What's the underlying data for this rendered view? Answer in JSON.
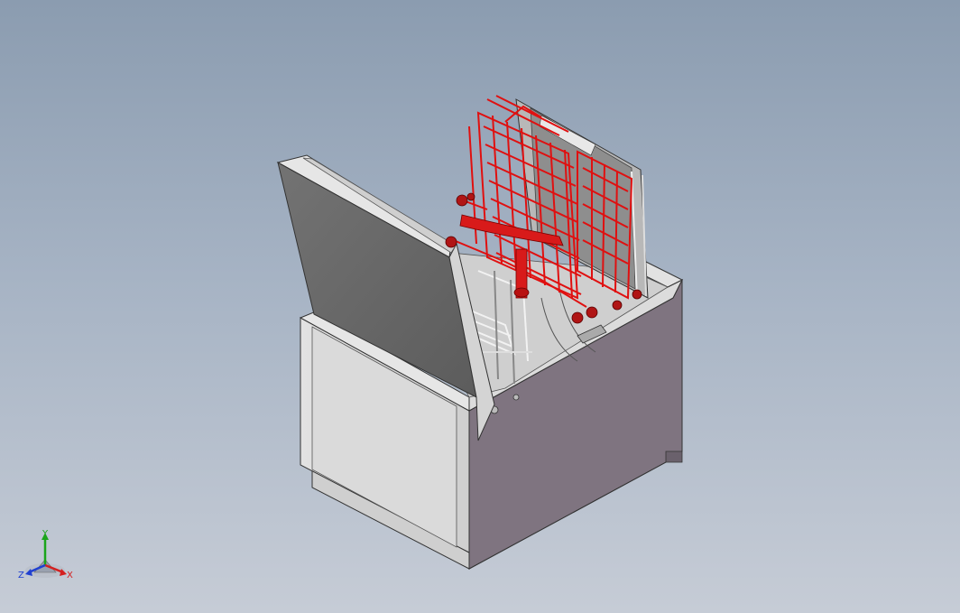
{
  "viewport": {
    "background_top": "#8b9cb0",
    "background_bottom": "#c6ccd6"
  },
  "model": {
    "description_colors": {
      "housing": "#d2d2d2",
      "housing_front": "#7f7480",
      "lid": "#6a6a6a",
      "rack": "#e01010"
    }
  },
  "triad": {
    "y_label": "Y",
    "x_label": "X",
    "z_label": "Z",
    "y_color": "#1ba51b",
    "x_color": "#d42020",
    "z_color": "#2040d0"
  }
}
